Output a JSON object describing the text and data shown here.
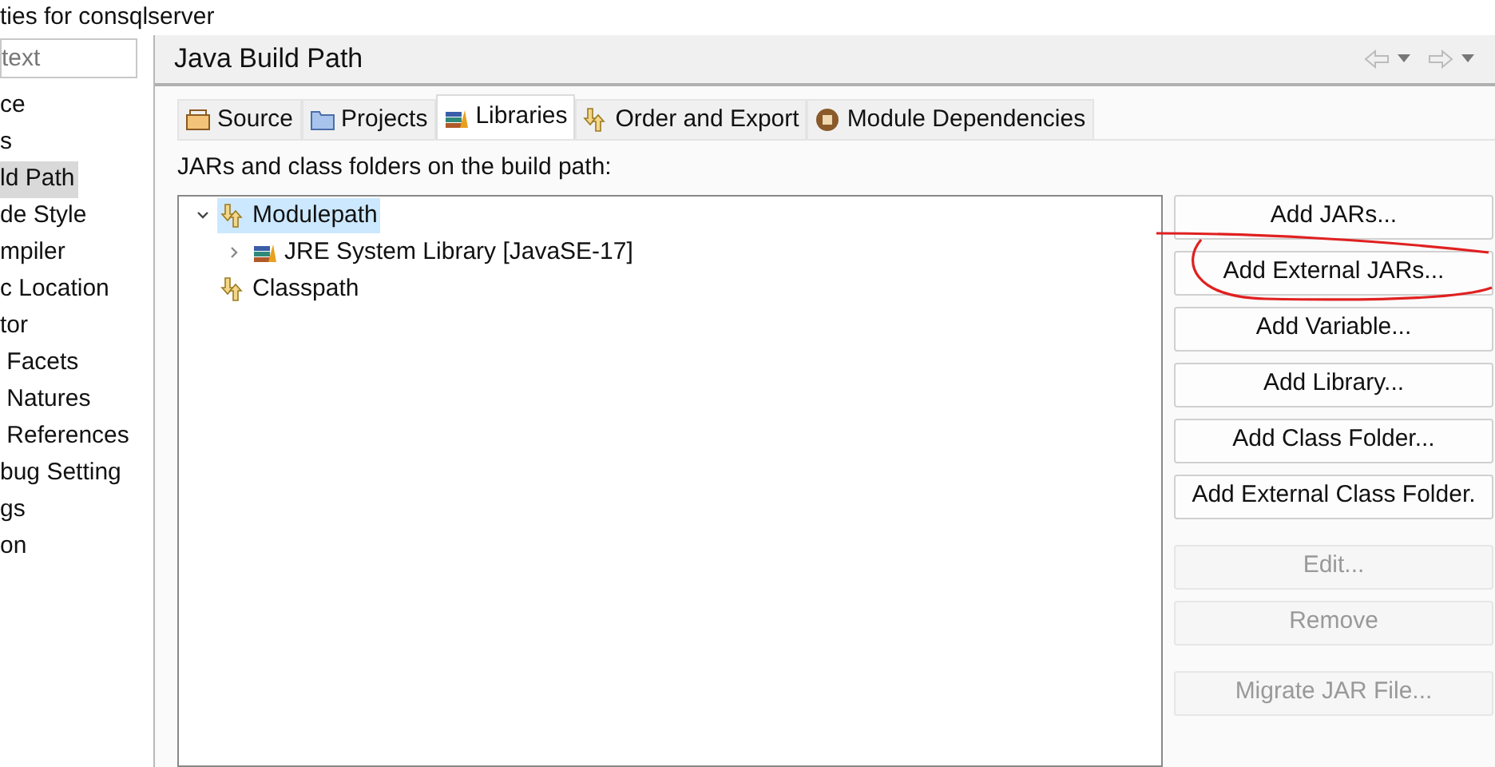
{
  "window": {
    "title": "ties for consqlserver"
  },
  "sidebar": {
    "filter": {
      "placeholder": "text"
    },
    "items": [
      {
        "label": "ce",
        "selected": false
      },
      {
        "label": "s",
        "selected": false
      },
      {
        "label": "ld Path",
        "selected": true
      },
      {
        "label": "de Style",
        "selected": false
      },
      {
        "label": "mpiler",
        "selected": false
      },
      {
        "label": "c Location",
        "selected": false
      },
      {
        "label": "tor",
        "selected": false
      },
      {
        "label": " Facets",
        "selected": false
      },
      {
        "label": " Natures",
        "selected": false
      },
      {
        "label": " References",
        "selected": false
      },
      {
        "label": "bug Setting",
        "selected": false
      },
      {
        "label": "gs",
        "selected": false
      },
      {
        "label": "on",
        "selected": false
      }
    ]
  },
  "page": {
    "title": "Java Build Path",
    "tabs": [
      {
        "label": "Source",
        "kind": "source",
        "selected": false
      },
      {
        "label": "Projects",
        "kind": "projects",
        "selected": false
      },
      {
        "label": "Libraries",
        "kind": "libraries",
        "selected": true
      },
      {
        "label": "Order and Export",
        "kind": "order",
        "selected": false
      },
      {
        "label": "Module Dependencies",
        "kind": "module",
        "selected": false
      }
    ],
    "list_label": "JARs and class folders on the build path:",
    "tree": [
      {
        "label": "Modulepath",
        "kind": "path",
        "selected": true,
        "expanded": true,
        "children": [
          {
            "label": "JRE System Library [JavaSE-17]",
            "kind": "library",
            "selected": false,
            "expanded": false
          }
        ]
      },
      {
        "label": "Classpath",
        "kind": "path",
        "selected": false
      }
    ],
    "button_groups": [
      [
        {
          "label": "Add JARs...",
          "disabled": false
        },
        {
          "label": "Add External JARs...",
          "disabled": false
        },
        {
          "label": "Add Variable...",
          "disabled": false
        },
        {
          "label": "Add Library...",
          "disabled": false
        },
        {
          "label": "Add Class Folder...",
          "disabled": false
        },
        {
          "label": "Add External Class Folder.",
          "disabled": false
        }
      ],
      [
        {
          "label": "Edit...",
          "disabled": true
        },
        {
          "label": "Remove",
          "disabled": true
        }
      ],
      [
        {
          "label": "Migrate JAR File...",
          "disabled": true
        }
      ]
    ]
  }
}
